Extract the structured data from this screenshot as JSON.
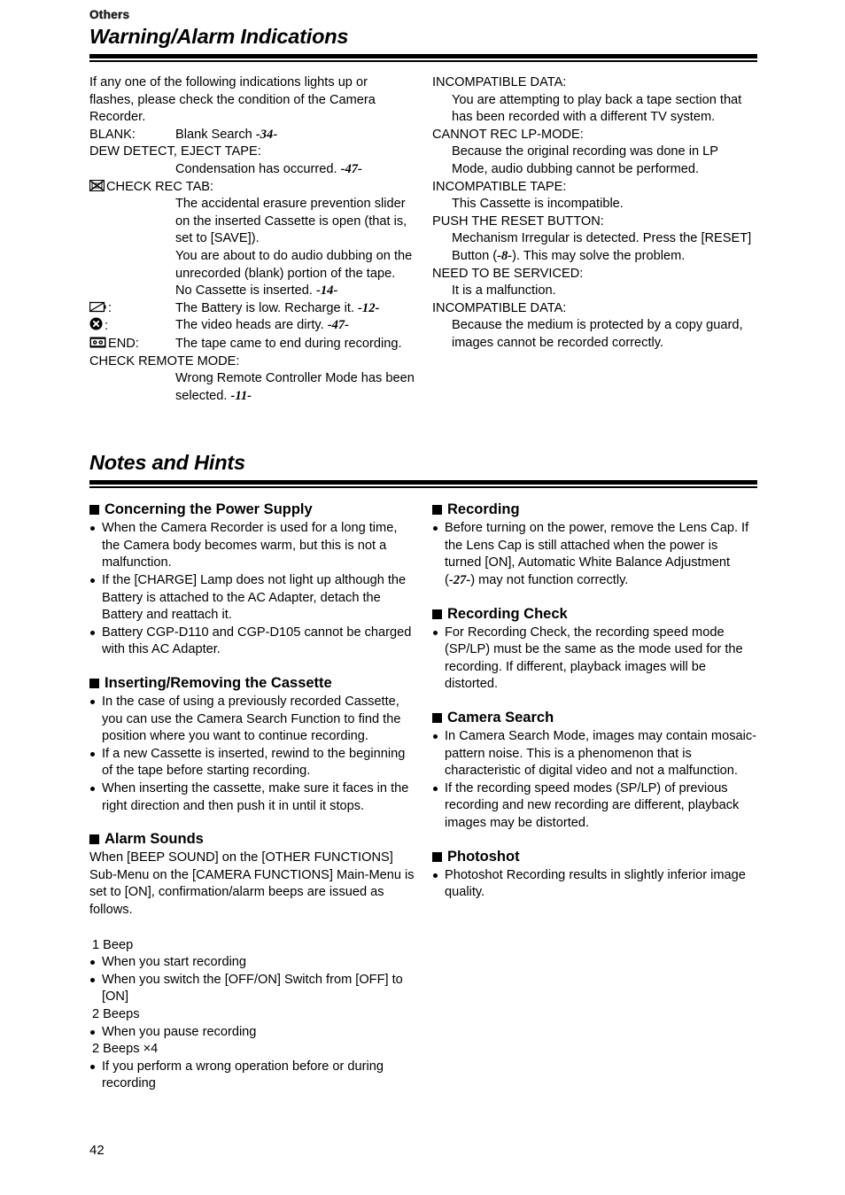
{
  "running_head": "Others",
  "page_number": "42",
  "sections": [
    {
      "title": "Warning/Alarm Indications",
      "intro": "If any one of the following indications lights up or flashes, please check the condition of the Camera Recorder.",
      "left_entries": [
        {
          "kind": "inline",
          "term": "BLANK:",
          "desc": "Blank Search ",
          "ref": "-34-"
        },
        {
          "kind": "stacked",
          "term": "DEW DETECT, EJECT TAPE:",
          "desc": "Condensation has occurred. ",
          "ref": "-47-"
        },
        {
          "kind": "icon-stacked",
          "icon": "check-rec-tab-icon",
          "term": "CHECK REC TAB:",
          "desc_lines": [
            "The accidental erasure prevention slider on the inserted Cassette is open (that is, set to [SAVE]).",
            "You are about to do audio dubbing on the unrecorded (blank) portion of the tape."
          ],
          "desc_final": "No Cassette is inserted. ",
          "ref": "-14-"
        },
        {
          "kind": "icon-inline",
          "icon": "battery-low-icon",
          "term": ":",
          "desc": "The Battery is low. Recharge it. ",
          "ref": "-12-"
        },
        {
          "kind": "icon-inline",
          "icon": "dirty-heads-icon",
          "term": ":",
          "desc": "The video heads are dirty. ",
          "ref": "-47-"
        },
        {
          "kind": "icon-inline",
          "icon": "tape-end-icon",
          "term": "END:",
          "desc": "The tape came to end during recording.",
          "ref": ""
        },
        {
          "kind": "stacked",
          "term": "CHECK REMOTE MODE:",
          "desc": "Wrong Remote Controller Mode has been selected. ",
          "ref": "-11-"
        }
      ],
      "right_entries": [
        {
          "term": "INCOMPATIBLE DATA:",
          "desc": "You are attempting to play back a tape section that has been recorded with a different TV system.",
          "ref": ""
        },
        {
          "term": "CANNOT REC LP-MODE:",
          "desc": "Because the original recording was done in LP Mode, audio dubbing cannot be performed.",
          "ref": ""
        },
        {
          "term": "INCOMPATIBLE TAPE:",
          "desc": "This Cassette is incompatible.",
          "ref": ""
        },
        {
          "term": "PUSH THE RESET BUTTON:",
          "desc_pre": "Mechanism Irregular is detected. Press the [RESET] Button (",
          "ref": "-8-",
          "desc_post": "). This may solve the problem."
        },
        {
          "term": "NEED TO BE SERVICED:",
          "desc": "It is a malfunction.",
          "ref": ""
        },
        {
          "term": "INCOMPATIBLE DATA:",
          "desc": "Because the medium is protected by a copy guard, images cannot be recorded correctly.",
          "ref": ""
        }
      ]
    },
    {
      "title": "Notes and Hints",
      "left_groups": [
        {
          "heading": "Concerning the Power Supply",
          "bullets": [
            "When the Camera Recorder is used for a long time, the Camera body becomes warm, but this is not a malfunction.",
            "If the [CHARGE] Lamp does not light up although the Battery is attached to the AC Adapter, detach the Battery and reattach it.",
            "Battery CGP-D110 and CGP-D105 cannot be charged with this AC Adapter."
          ]
        },
        {
          "heading": "Inserting/Removing the Cassette",
          "bullets": [
            "In the case of using a previously recorded Cassette, you can use the Camera Search Function to find the position where you want to continue recording.",
            "If a new Cassette is inserted, rewind to the beginning of the tape before starting recording.",
            "When inserting the cassette, make sure it faces in the right direction and then push it in until it stops."
          ]
        },
        {
          "heading": "Alarm Sounds",
          "paragraph": "When [BEEP SOUND] on the [OTHER FUNCTIONS] Sub-Menu on the [CAMERA FUNCTIONS] Main-Menu is set to [ON], confirmation/alarm beeps are issued as follows.",
          "beep_list": [
            {
              "count": "1  Beep",
              "bullets": [
                "When you start recording",
                "When you switch the [OFF/ON] Switch from [OFF] to [ON]"
              ]
            },
            {
              "count": "2  Beeps",
              "bullets": [
                "When you pause recording"
              ]
            },
            {
              "count": "2  Beeps ×4",
              "bullets": [
                "If you perform a wrong operation before or during recording"
              ]
            }
          ]
        }
      ],
      "right_groups": [
        {
          "heading": "Recording",
          "bullets_rich": [
            {
              "pre": "Before turning on the power, remove the Lens Cap. If the Lens Cap is still attached when the power is turned [ON], Automatic White Balance Adjustment (",
              "ref": "-27-",
              "post": ") may not function correctly."
            }
          ]
        },
        {
          "heading": "Recording Check",
          "bullets": [
            "For Recording Check, the recording speed mode (SP/LP) must be the same as the mode used for the recording. If different, playback images will be distorted."
          ]
        },
        {
          "heading": "Camera Search",
          "bullets": [
            "In Camera Search Mode, images may contain mosaic-pattern noise. This is a phenomenon that is characteristic of digital video and not a malfunction.",
            "If the recording speed modes (SP/LP) of previous recording and new recording are different, playback images may be distorted."
          ]
        },
        {
          "heading": "Photoshot",
          "bullets": [
            "Photoshot Recording results in slightly inferior image quality."
          ]
        }
      ]
    }
  ]
}
